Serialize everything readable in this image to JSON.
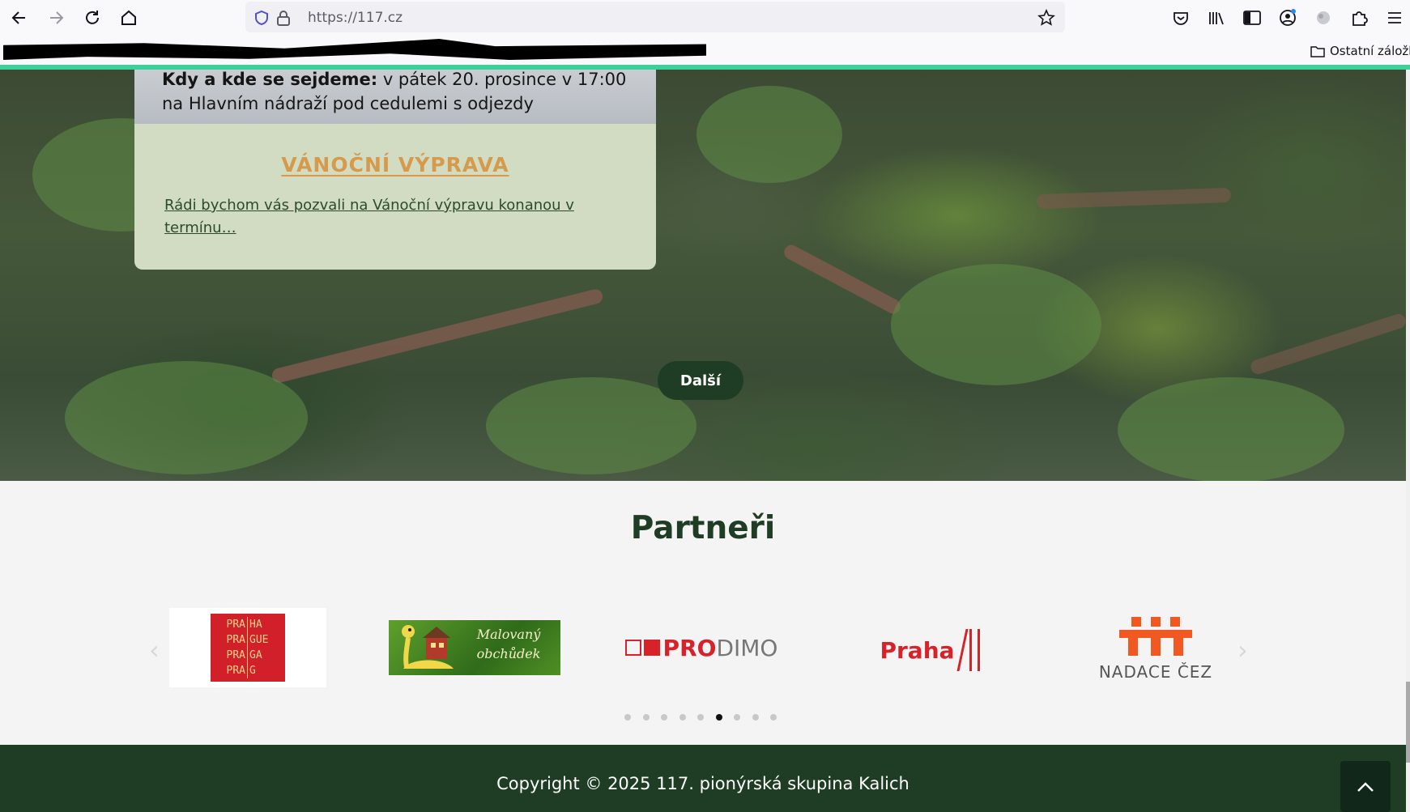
{
  "browser": {
    "url": "https://117.cz",
    "bookmarks_folder_label": "Ostatní záložky"
  },
  "event": {
    "meet_label": "Kdy a kde se sejdeme:",
    "meet_text": " v pátek 20. prosince v 17:00",
    "meet_text_line2": "na Hlavním nádraží pod cedulemi s odjezdy",
    "title": "VÁNOČNÍ VÝPRAVA",
    "excerpt": "Rádi bychom vás pozvali na Vánoční výpravu konanou v termínu…"
  },
  "hero": {
    "next_label": "Další"
  },
  "partners": {
    "title": "Partneři",
    "praha_logo_lines": [
      "PRA",
      "HA",
      "PRA",
      "GUE",
      "PRA",
      "GA",
      "PRA",
      "G"
    ],
    "malovany_line1": "Malovaný",
    "malovany_line2": "obchůdek",
    "prodimo_pro": "PRO",
    "prodimo_dimo": "DIMO",
    "praha3_label": "Praha",
    "cez_label": "NADACE ČEZ",
    "carousel_page_count": 9,
    "carousel_active_page": 6
  },
  "footer": {
    "copyright": "Copyright © 2025 117. pionýrská skupina Kalich"
  },
  "colors": {
    "accent_green": "#1e3d24",
    "event_title": "#d69a4a",
    "card_body": "#d2dcc3",
    "progress": "#3fcf9b"
  },
  "icons": [
    "back-icon",
    "forward-icon",
    "reload-icon",
    "home-icon",
    "shield-icon",
    "lock-icon",
    "star-icon",
    "pocket-icon",
    "library-icon",
    "sidebar-icon",
    "account-icon",
    "extension-puzzle-icon",
    "menu-icon",
    "folder-icon",
    "chevron-left-icon",
    "chevron-right-icon",
    "chevron-up-icon"
  ]
}
